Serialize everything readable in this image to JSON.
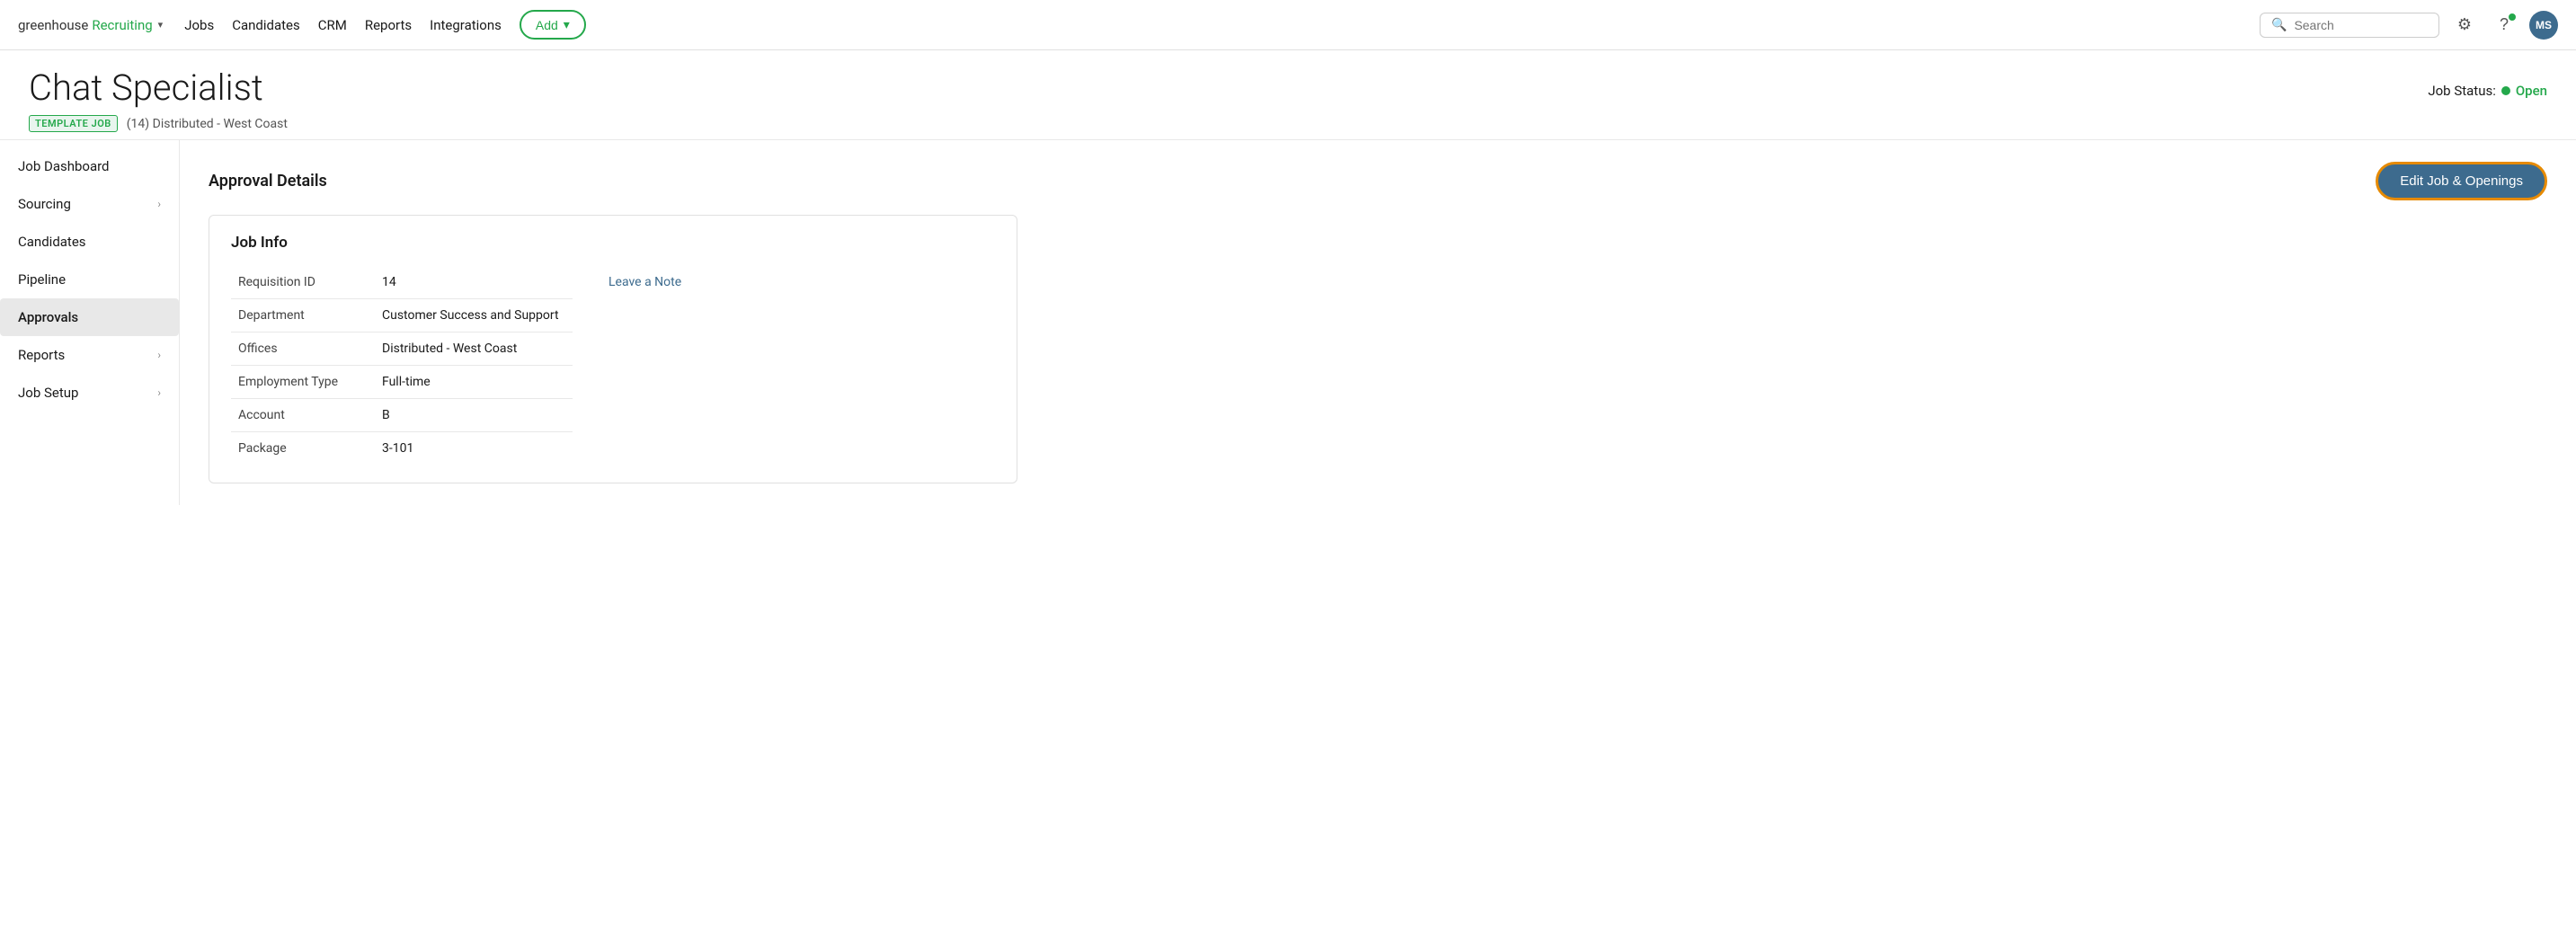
{
  "nav": {
    "logo_greenhouse": "greenhouse",
    "logo_recruiting": "Recruiting",
    "links": [
      {
        "label": "Jobs",
        "id": "jobs"
      },
      {
        "label": "Candidates",
        "id": "candidates"
      },
      {
        "label": "CRM",
        "id": "crm"
      },
      {
        "label": "Reports",
        "id": "reports"
      },
      {
        "label": "Integrations",
        "id": "integrations"
      }
    ],
    "add_label": "Add",
    "search_placeholder": "Search",
    "avatar_label": "MS"
  },
  "page": {
    "job_title": "Chat Specialist",
    "template_badge": "TEMPLATE JOB",
    "job_subtitle": "(14) Distributed - West Coast",
    "job_status_label": "Job Status:",
    "job_status_value": "Open"
  },
  "sidebar": {
    "items": [
      {
        "label": "Job Dashboard",
        "id": "job-dashboard",
        "has_arrow": false,
        "active": false
      },
      {
        "label": "Sourcing",
        "id": "sourcing",
        "has_arrow": true,
        "active": false
      },
      {
        "label": "Candidates",
        "id": "candidates",
        "has_arrow": false,
        "active": false
      },
      {
        "label": "Pipeline",
        "id": "pipeline",
        "has_arrow": false,
        "active": false
      },
      {
        "label": "Approvals",
        "id": "approvals",
        "has_arrow": false,
        "active": true
      },
      {
        "label": "Reports",
        "id": "reports",
        "has_arrow": true,
        "active": false
      },
      {
        "label": "Job Setup",
        "id": "job-setup",
        "has_arrow": true,
        "active": false
      }
    ]
  },
  "main": {
    "section_title": "Approval Details",
    "edit_button_label": "Edit Job & Openings",
    "card": {
      "title": "Job Info",
      "fields": [
        {
          "label": "Requisition ID",
          "value": "14"
        },
        {
          "label": "Department",
          "value": "Customer Success and Support"
        },
        {
          "label": "Offices",
          "value": "Distributed - West Coast"
        },
        {
          "label": "Employment Type",
          "value": "Full-time"
        },
        {
          "label": "Account",
          "value": "B"
        },
        {
          "label": "Package",
          "value": "3-101"
        }
      ],
      "leave_note_label": "Leave a Note"
    }
  }
}
